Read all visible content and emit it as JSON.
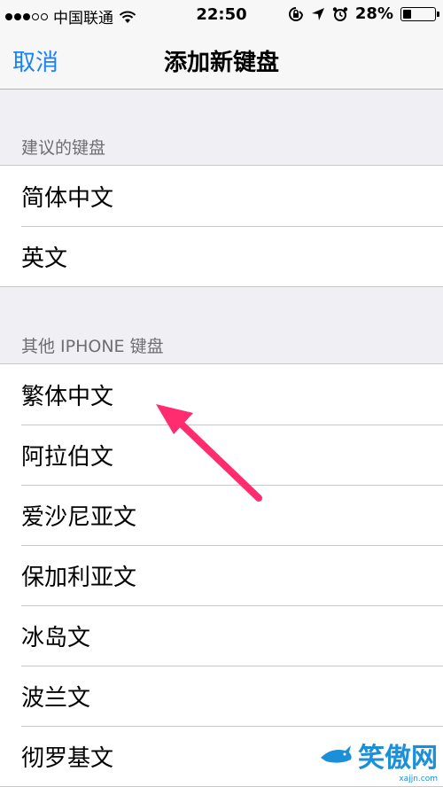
{
  "status_bar": {
    "carrier": "中国联通",
    "time": "22:50",
    "battery": "28%",
    "battery_level": 0.28
  },
  "nav": {
    "cancel_label": "取消",
    "title": "添加新键盘"
  },
  "sections": [
    {
      "header": "建议的键盘",
      "items": [
        "简体中文",
        "英文"
      ]
    },
    {
      "header": "其他 IPHONE 键盘",
      "items": [
        "繁体中文",
        "阿拉伯文",
        "爱沙尼亚文",
        "保加利亚文",
        "冰岛文",
        "波兰文",
        "彻罗基文"
      ]
    }
  ],
  "watermark": {
    "text": "笑傲网",
    "url": "xajjn.com"
  },
  "colors": {
    "accent": "#1a82f7",
    "arrow": "#ff2d6f",
    "background": "#efeff4"
  }
}
